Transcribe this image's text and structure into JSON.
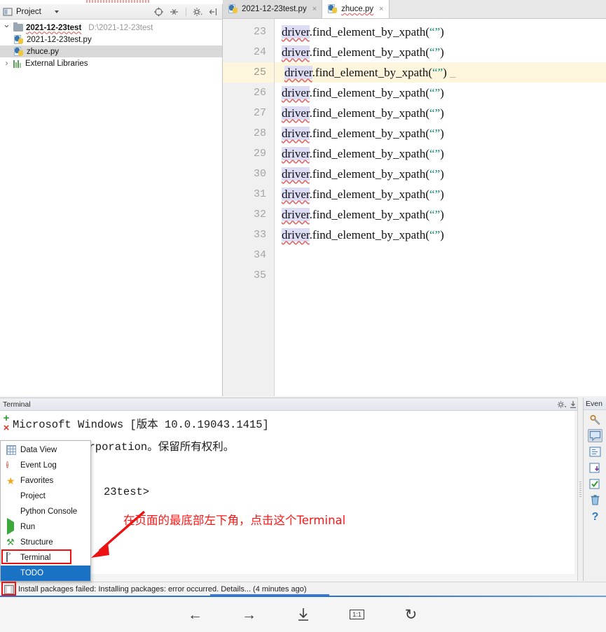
{
  "project_panel": {
    "title": "Project",
    "icons": [
      "project-view-icon",
      "chevron-down-icon",
      "locate-target-icon",
      "collapse-all-icon",
      "gear-icon",
      "hide-panel-icon"
    ],
    "tree": [
      {
        "name": "2021-12-23test",
        "path": "D:\\2021-12-23test",
        "type": "folder",
        "expanded": true,
        "selected": false
      },
      {
        "name": "2021-12-23test.py",
        "path": "",
        "type": "python-file",
        "expanded": false,
        "selected": false
      },
      {
        "name": "zhuce.py",
        "path": "",
        "type": "python-file",
        "expanded": false,
        "selected": true
      },
      {
        "name": "External Libraries",
        "path": "",
        "type": "libraries",
        "expanded": false,
        "selected": false
      }
    ]
  },
  "editor": {
    "tabs": [
      {
        "label": "2021-12-23test.py",
        "active": false,
        "close": "×"
      },
      {
        "label": "zhuce.py",
        "active": true,
        "close": "×"
      }
    ],
    "current_line": 25,
    "lines": [
      {
        "num": "23",
        "indent": "",
        "obj": "driver",
        "call": ".find_element_by_xpath(",
        "arg": "“”",
        "close": ")"
      },
      {
        "num": "24",
        "indent": "",
        "obj": "driver",
        "call": ".find_element_by_xpath(",
        "arg": "“”",
        "close": ")"
      },
      {
        "num": "25",
        "indent": " ",
        "obj": "driver",
        "call": ".find_element_by_xpath(",
        "arg": "“”",
        "close": ")"
      },
      {
        "num": "26",
        "indent": "",
        "obj": "driver",
        "call": ".find_element_by_xpath(",
        "arg": "“”",
        "close": ")"
      },
      {
        "num": "27",
        "indent": "",
        "obj": "driver",
        "call": ".find_element_by_xpath(",
        "arg": "“”",
        "close": ")"
      },
      {
        "num": "28",
        "indent": "",
        "obj": "driver",
        "call": ".find_element_by_xpath(",
        "arg": "“”",
        "close": ")"
      },
      {
        "num": "29",
        "indent": "",
        "obj": "driver",
        "call": ".find_element_by_xpath(",
        "arg": "“”",
        "close": ")"
      },
      {
        "num": "30",
        "indent": "",
        "obj": "driver",
        "call": ".find_element_by_xpath(",
        "arg": "“”",
        "close": ")"
      },
      {
        "num": "31",
        "indent": "",
        "obj": "driver",
        "call": ".find_element_by_xpath(",
        "arg": "“”",
        "close": ")"
      },
      {
        "num": "32",
        "indent": "",
        "obj": "driver",
        "call": ".find_element_by_xpath(",
        "arg": "“”",
        "close": ")"
      },
      {
        "num": "33",
        "indent": "",
        "obj": "driver",
        "call": ".find_element_by_xpath(",
        "arg": "“”",
        "close": ")"
      },
      {
        "num": "34",
        "indent": "",
        "obj": "",
        "call": "",
        "arg": "",
        "close": ""
      },
      {
        "num": "35",
        "indent": "",
        "obj": "",
        "call": "",
        "arg": "",
        "close": ""
      }
    ]
  },
  "terminal": {
    "title": "Terminal",
    "new_tab_glyph": "+",
    "close_glyph": "×",
    "gear_icon": "gear-icon",
    "minimize_icon": "minimize-icon",
    "lines": [
      "Microsoft Windows [版本 10.0.19043.1415]",
      "ft Corporation。保留所有权利。",
      "23test>"
    ]
  },
  "view_menu": {
    "items": [
      {
        "label": "Data View",
        "icon": "data-view-icon",
        "selected": false
      },
      {
        "label": "Event Log",
        "icon": "event-log-icon",
        "selected": false
      },
      {
        "label": "Favorites",
        "icon": "favorites-star-icon",
        "selected": false
      },
      {
        "label": "Project",
        "icon": "project-icon",
        "selected": false
      },
      {
        "label": "Python Console",
        "icon": "python-console-icon",
        "selected": false
      },
      {
        "label": "Run",
        "icon": "run-play-icon",
        "selected": false
      },
      {
        "label": "Structure",
        "icon": "structure-icon",
        "selected": false
      },
      {
        "label": "Terminal",
        "icon": "terminal-icon",
        "selected": false
      },
      {
        "label": "TODO",
        "icon": "todo-icon",
        "selected": true
      }
    ]
  },
  "annotation": {
    "text": "在页面的最底部左下角，点击这个Terminal",
    "color": "#ff1616",
    "highlight_target": "Terminal"
  },
  "event_log": {
    "title": "Even",
    "buttons": [
      "settings-wrench-icon",
      "balloon-notification-icon",
      "expand-all-icon",
      "export-icon",
      "mark-read-icon",
      "delete-trash-icon",
      "help-question-icon"
    ]
  },
  "status_bar": {
    "icon": "panel-toggle-icon",
    "message": "Install packages failed: Installing packages: error occurred. Details... (4 minutes ago)"
  },
  "bottom_nav": {
    "buttons": [
      {
        "name": "back-arrow-icon",
        "glyph": "←"
      },
      {
        "name": "forward-arrow-icon",
        "glyph": "→"
      },
      {
        "name": "download-icon",
        "glyph": "↓"
      },
      {
        "name": "zoom-actual-size",
        "glyph": "1:1"
      },
      {
        "name": "refresh-icon",
        "glyph": "↻"
      }
    ]
  }
}
